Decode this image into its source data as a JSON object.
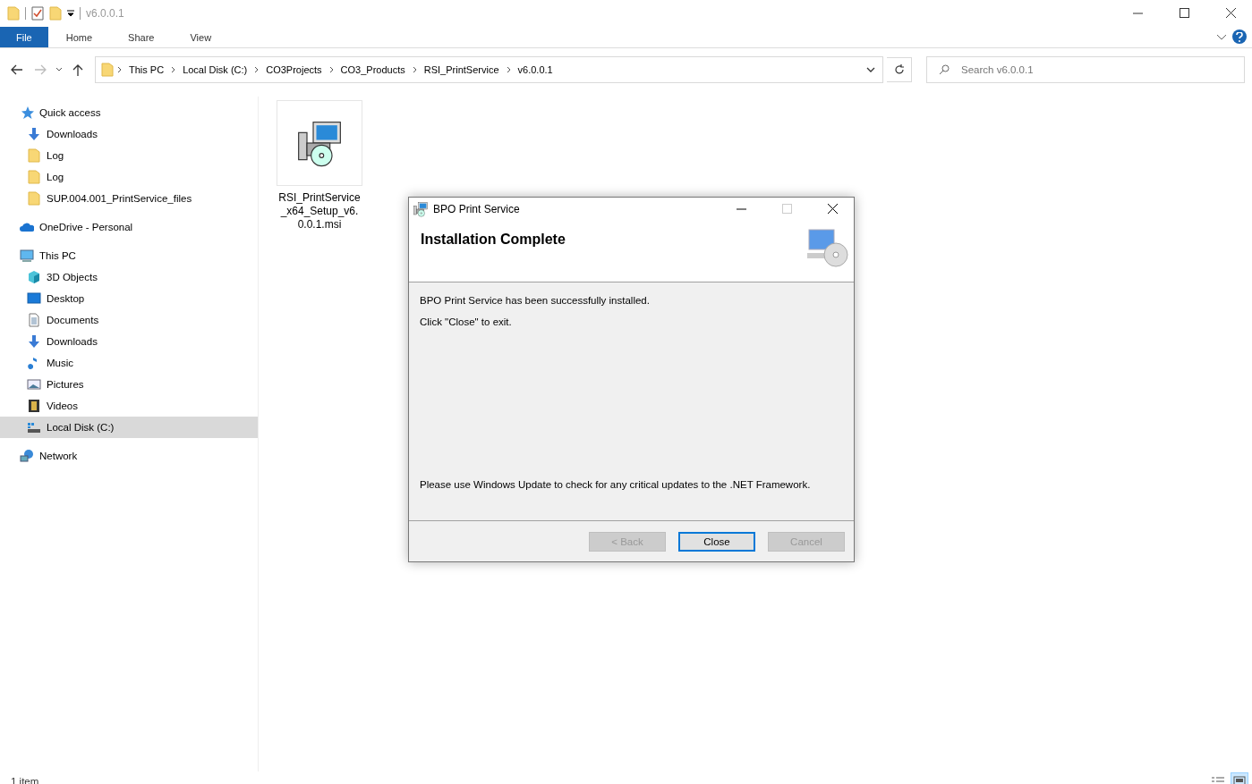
{
  "window": {
    "title": "v6.0.0.1"
  },
  "ribbon_tabs": [
    {
      "label": "File",
      "selected": true
    },
    {
      "label": "Home",
      "selected": false
    },
    {
      "label": "Share",
      "selected": false
    },
    {
      "label": "View",
      "selected": false
    }
  ],
  "breadcrumb": [
    "This PC",
    "Local Disk (C:)",
    "CO3Projects",
    "CO3_Products",
    "RSI_PrintService",
    "v6.0.0.1"
  ],
  "search": {
    "placeholder": "Search v6.0.0.1"
  },
  "sidebar": {
    "items": [
      {
        "label": "Quick access",
        "kind": "star",
        "selected": false,
        "children": [
          {
            "label": "Downloads",
            "kind": "download",
            "selected": false
          },
          {
            "label": "Log",
            "kind": "folder",
            "selected": false
          },
          {
            "label": "Log",
            "kind": "folder",
            "selected": false
          },
          {
            "label": "SUP.004.001_PrintService_files",
            "kind": "folder",
            "selected": false
          }
        ]
      },
      {
        "label": "OneDrive - Personal",
        "kind": "cloud",
        "selected": false
      },
      {
        "label": "This PC",
        "kind": "pc",
        "selected": false,
        "children": [
          {
            "label": "3D Objects",
            "kind": "cube",
            "selected": false
          },
          {
            "label": "Desktop",
            "kind": "desktop",
            "selected": false
          },
          {
            "label": "Documents",
            "kind": "document",
            "selected": false
          },
          {
            "label": "Downloads",
            "kind": "download",
            "selected": false
          },
          {
            "label": "Music",
            "kind": "music",
            "selected": false
          },
          {
            "label": "Pictures",
            "kind": "pictures",
            "selected": false
          },
          {
            "label": "Videos",
            "kind": "videos",
            "selected": false
          },
          {
            "label": "Local Disk (C:)",
            "kind": "drive",
            "selected": true
          }
        ]
      },
      {
        "label": "Network",
        "kind": "network",
        "selected": false
      }
    ]
  },
  "files": [
    {
      "name": "RSI_PrintService_x64_Setup_v6.0.0.1.msi"
    }
  ],
  "status_bar": {
    "count": "1 item"
  },
  "dialog": {
    "title": "BPO Print Service",
    "heading": "Installation Complete",
    "messages": [
      "BPO Print Service has been successfully installed.",
      "Click \"Close\" to exit."
    ],
    "footer_note": "Please use Windows Update to check for any critical updates to the .NET Framework.",
    "buttons": [
      {
        "label": "< Back",
        "disabled": true,
        "default": false
      },
      {
        "label": "Close",
        "disabled": false,
        "default": true
      },
      {
        "label": "Cancel",
        "disabled": true,
        "default": false
      }
    ]
  }
}
